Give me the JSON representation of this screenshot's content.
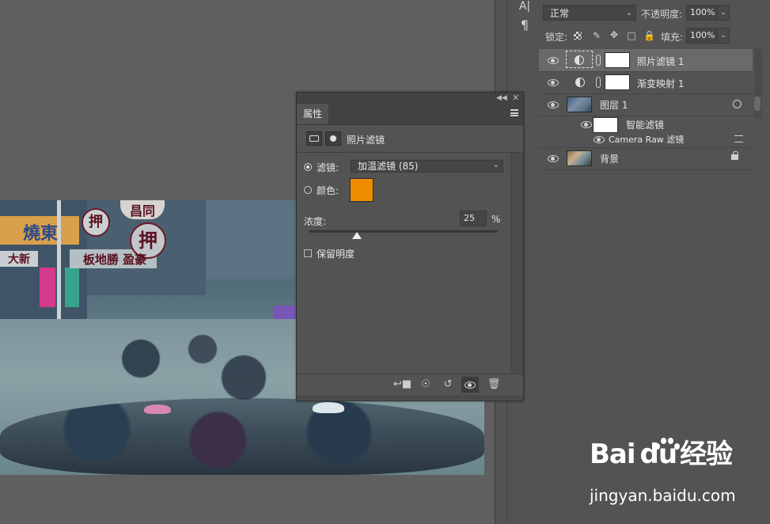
{
  "canvas": {
    "signs": [
      "燒東",
      "押",
      "昌同",
      "押",
      "板地勝 盈豪",
      "大新"
    ]
  },
  "side_tools": {
    "text_tool_glyph": "A|",
    "paragraph_glyph": "¶"
  },
  "layers_panel": {
    "blend_mode": "正常",
    "opacity_label": "不透明度:",
    "opacity_value": "100%",
    "lock_label": "锁定:",
    "fill_label": "填充:",
    "fill_value": "100%",
    "layers": [
      {
        "name": "照片滤镜 1",
        "type": "adjustment",
        "selected": true
      },
      {
        "name": "渐变映射 1",
        "type": "adjustment",
        "selected": false
      },
      {
        "name": "图层 1",
        "type": "smart-object",
        "selected": false
      },
      {
        "name": "智能滤镜",
        "type": "smart-filter-group",
        "selected": false
      },
      {
        "name": "Camera Raw 滤镜",
        "type": "smart-filter",
        "selected": false
      },
      {
        "name": "背景",
        "type": "background",
        "selected": false
      }
    ]
  },
  "properties_panel": {
    "tab_label": "属性",
    "header_title": "照片滤镜",
    "filter_label": "滤镜:",
    "filter_value": "加温滤镜 (85)",
    "color_label": "颜色:",
    "color_hex": "#f08c00",
    "density_label": "浓度:",
    "density_value": "25",
    "density_unit": "%",
    "density_fraction": 0.25,
    "preserve_label": "保留明度",
    "preserve_checked": false
  },
  "watermark": {
    "logo_text_left": "Bai",
    "logo_text_right": "经验",
    "logo_mid": "du",
    "url": "jingyan.baidu.com"
  }
}
